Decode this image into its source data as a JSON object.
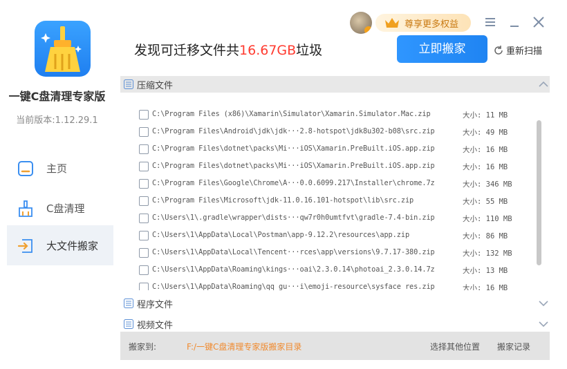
{
  "app": {
    "title": "一键C盘清理专家版",
    "version": "当前版本:1.12.29.1"
  },
  "nav": [
    {
      "label": "主页",
      "icon": "home-icon",
      "active": false
    },
    {
      "label": "C盘清理",
      "icon": "broom-icon",
      "active": false
    },
    {
      "label": "大文件搬家",
      "icon": "move-icon",
      "active": true
    }
  ],
  "header": {
    "summary_prefix": "发现可迁移文件共",
    "summary_amount": "16.67GB",
    "summary_suffix": "垃圾",
    "vip_label": "尊享更多权益",
    "move_button": "立即搬家",
    "rescan_label": "重新扫描"
  },
  "sections": [
    {
      "title": "压缩文件",
      "expanded": true
    },
    {
      "title": "程序文件",
      "expanded": false
    },
    {
      "title": "视频文件",
      "expanded": false
    }
  ],
  "files": [
    {
      "path": "C:\\Program Files (x86)\\Xamarin\\Simulator\\Xamarin.Simulator.Mac.zip",
      "size": "大小: 11 MB"
    },
    {
      "path": "C:\\Program Files\\Android\\jdk\\jdk···2.8-hotspot\\jdk8u302-b08\\src.zip",
      "size": "大小: 49 MB"
    },
    {
      "path": "C:\\Program Files\\dotnet\\packs\\Mi···iOS\\Xamarin.PreBuilt.iOS.app.zip",
      "size": "大小: 16 MB"
    },
    {
      "path": "C:\\Program Files\\dotnet\\packs\\Mi···iOS\\Xamarin.PreBuilt.iOS.app.zip",
      "size": "大小: 16 MB"
    },
    {
      "path": "C:\\Program Files\\Google\\Chrome\\A···0.0.6099.217\\Installer\\chrome.7z",
      "size": "大小: 346 MB"
    },
    {
      "path": "C:\\Program Files\\Microsoft\\jdk-11.0.16.101-hotspot\\lib\\src.zip",
      "size": "大小: 55 MB"
    },
    {
      "path": "C:\\Users\\1\\.gradle\\wrapper\\dists···qw7r0h0umtfvt\\gradle-7.4-bin.zip",
      "size": "大小: 110 MB"
    },
    {
      "path": "C:\\Users\\1\\AppData\\Local\\Postman\\app-9.12.2\\resources\\app.zip",
      "size": "大小: 86 MB"
    },
    {
      "path": "C:\\Users\\1\\AppData\\Local\\Tencent···rces\\app\\versions\\9.7.17-380.zip",
      "size": "大小: 132 MB"
    },
    {
      "path": "C:\\Users\\1\\AppData\\Roaming\\kings···oai\\2.3.0.14\\photoai_2.3.0.14.7z",
      "size": "大小: 13 MB"
    },
    {
      "path": "C:\\Users\\1\\AppData\\Roaming\\qq_gu···i\\emoji-resource\\sysface_res.zip",
      "size": "大小: 16 MB"
    }
  ],
  "footer": {
    "label": "搬家到:",
    "destination": "F:/一键C盘清理专家版搬家目录",
    "choose_other": "选择其他位置",
    "history": "搬家记录"
  }
}
